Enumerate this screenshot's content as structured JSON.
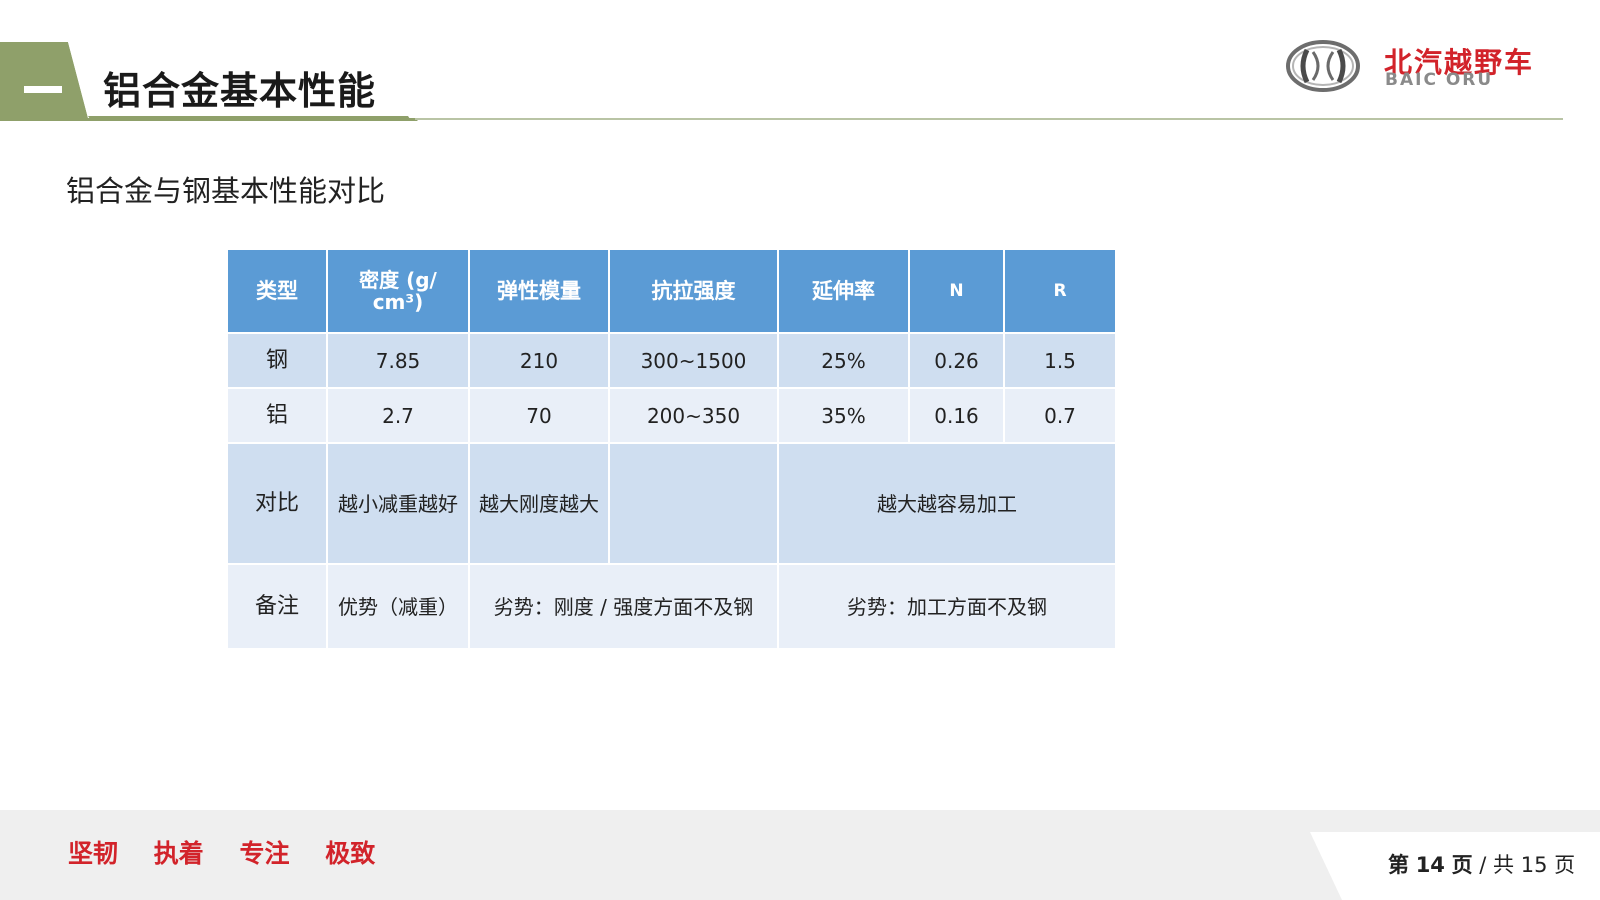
{
  "header": {
    "title": "铝合金基本性能"
  },
  "brand": {
    "name_cn": "北汽越野车",
    "name_en": "BAIC ORU"
  },
  "subtitle": "铝合金与钢基本性能对比",
  "table": {
    "headers": [
      "类型",
      "密度 (g/",
      "cm³)",
      "弹性模量",
      "抗拉强度",
      "延伸率",
      "N",
      "R"
    ],
    "rows": [
      [
        "钢",
        "7.85",
        "210",
        "300~1500",
        "25%",
        "0.26",
        "1.5"
      ],
      [
        "铝",
        "2.7",
        "70",
        "200~350",
        "35%",
        "0.16",
        "0.7"
      ]
    ],
    "compare": {
      "label": "对比",
      "density": "越小减重越好",
      "modulus": "越大刚度越大",
      "ductility": "越大越容易加工"
    },
    "note": {
      "label": "备注",
      "density": "优势（减重）",
      "strength": "劣势：刚度 / 强度方面不及钢",
      "ductility": "劣势：加工方面不及钢"
    }
  },
  "footer": {
    "slogans": [
      "坚韧",
      "执着",
      "专注",
      "极致"
    ],
    "page_prefix": "第",
    "page_current": "14",
    "page_mid": "页",
    "page_sep": "/ 共",
    "page_total": "15",
    "page_suffix": "页"
  },
  "colors": {
    "accent_green": "#8fa06a",
    "header_blue": "#5b9bd5",
    "brand_red": "#d2232a"
  }
}
